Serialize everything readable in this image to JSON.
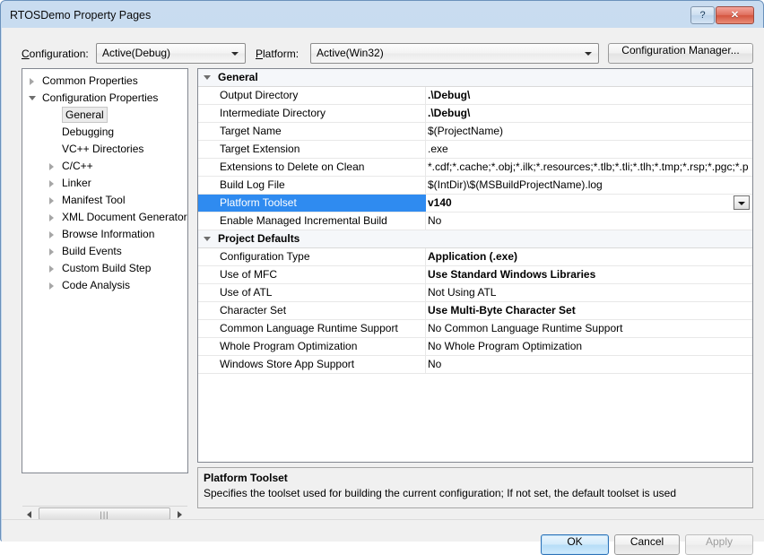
{
  "window": {
    "title": "RTOSDemo Property Pages",
    "help_button": "?",
    "close_button": "✕"
  },
  "toolbar": {
    "configuration_label": "Configuration:",
    "configuration_value": "Active(Debug)",
    "platform_label": "Platform:",
    "platform_value": "Active(Win32)",
    "configuration_manager_label": "Configuration Manager..."
  },
  "tree": {
    "items": [
      {
        "label": "Common Properties",
        "indent": 0,
        "state": "collapsed",
        "selected": false
      },
      {
        "label": "Configuration Properties",
        "indent": 0,
        "state": "expanded",
        "selected": false
      },
      {
        "label": "General",
        "indent": 1,
        "state": "leaf",
        "selected": true
      },
      {
        "label": "Debugging",
        "indent": 1,
        "state": "leaf",
        "selected": false
      },
      {
        "label": "VC++ Directories",
        "indent": 1,
        "state": "leaf",
        "selected": false
      },
      {
        "label": "C/C++",
        "indent": 1,
        "state": "collapsed",
        "selected": false
      },
      {
        "label": "Linker",
        "indent": 1,
        "state": "collapsed",
        "selected": false
      },
      {
        "label": "Manifest Tool",
        "indent": 1,
        "state": "collapsed",
        "selected": false
      },
      {
        "label": "XML Document Generator",
        "indent": 1,
        "state": "collapsed",
        "selected": false
      },
      {
        "label": "Browse Information",
        "indent": 1,
        "state": "collapsed",
        "selected": false
      },
      {
        "label": "Build Events",
        "indent": 1,
        "state": "collapsed",
        "selected": false
      },
      {
        "label": "Custom Build Step",
        "indent": 1,
        "state": "collapsed",
        "selected": false
      },
      {
        "label": "Code Analysis",
        "indent": 1,
        "state": "collapsed",
        "selected": false
      }
    ]
  },
  "grid": {
    "rows": [
      {
        "kind": "category",
        "name": "General",
        "value": "",
        "bold": false,
        "selected": false
      },
      {
        "kind": "property",
        "name": "Output Directory",
        "value": ".\\Debug\\",
        "bold": true,
        "selected": false
      },
      {
        "kind": "property",
        "name": "Intermediate Directory",
        "value": ".\\Debug\\",
        "bold": true,
        "selected": false
      },
      {
        "kind": "property",
        "name": "Target Name",
        "value": "$(ProjectName)",
        "bold": false,
        "selected": false
      },
      {
        "kind": "property",
        "name": "Target Extension",
        "value": ".exe",
        "bold": false,
        "selected": false
      },
      {
        "kind": "property",
        "name": "Extensions to Delete on Clean",
        "value": "*.cdf;*.cache;*.obj;*.ilk;*.resources;*.tlb;*.tli;*.tlh;*.tmp;*.rsp;*.pgc;*.p",
        "bold": false,
        "selected": false
      },
      {
        "kind": "property",
        "name": "Build Log File",
        "value": "$(IntDir)\\$(MSBuildProjectName).log",
        "bold": false,
        "selected": false
      },
      {
        "kind": "property",
        "name": "Platform Toolset",
        "value": "v140",
        "bold": true,
        "selected": true
      },
      {
        "kind": "property",
        "name": "Enable Managed Incremental Build",
        "value": "No",
        "bold": false,
        "selected": false
      },
      {
        "kind": "category",
        "name": "Project Defaults",
        "value": "",
        "bold": false,
        "selected": false
      },
      {
        "kind": "property",
        "name": "Configuration Type",
        "value": "Application (.exe)",
        "bold": true,
        "selected": false
      },
      {
        "kind": "property",
        "name": "Use of MFC",
        "value": "Use Standard Windows Libraries",
        "bold": true,
        "selected": false
      },
      {
        "kind": "property",
        "name": "Use of ATL",
        "value": "Not Using ATL",
        "bold": false,
        "selected": false
      },
      {
        "kind": "property",
        "name": "Character Set",
        "value": "Use Multi-Byte Character Set",
        "bold": true,
        "selected": false
      },
      {
        "kind": "property",
        "name": "Common Language Runtime Support",
        "value": "No Common Language Runtime Support",
        "bold": false,
        "selected": false
      },
      {
        "kind": "property",
        "name": "Whole Program Optimization",
        "value": "No Whole Program Optimization",
        "bold": false,
        "selected": false
      },
      {
        "kind": "property",
        "name": "Windows Store App Support",
        "value": "No",
        "bold": false,
        "selected": false
      }
    ]
  },
  "description": {
    "title": "Platform Toolset",
    "body": "Specifies the toolset used for building the current configuration; If not set, the default toolset is used"
  },
  "footer": {
    "ok_label": "OK",
    "cancel_label": "Cancel",
    "apply_label": "Apply"
  },
  "colors": {
    "selection_blue": "#2f8bf0",
    "window_frame": "#bcd3ea",
    "close_red": "#d4543f"
  }
}
